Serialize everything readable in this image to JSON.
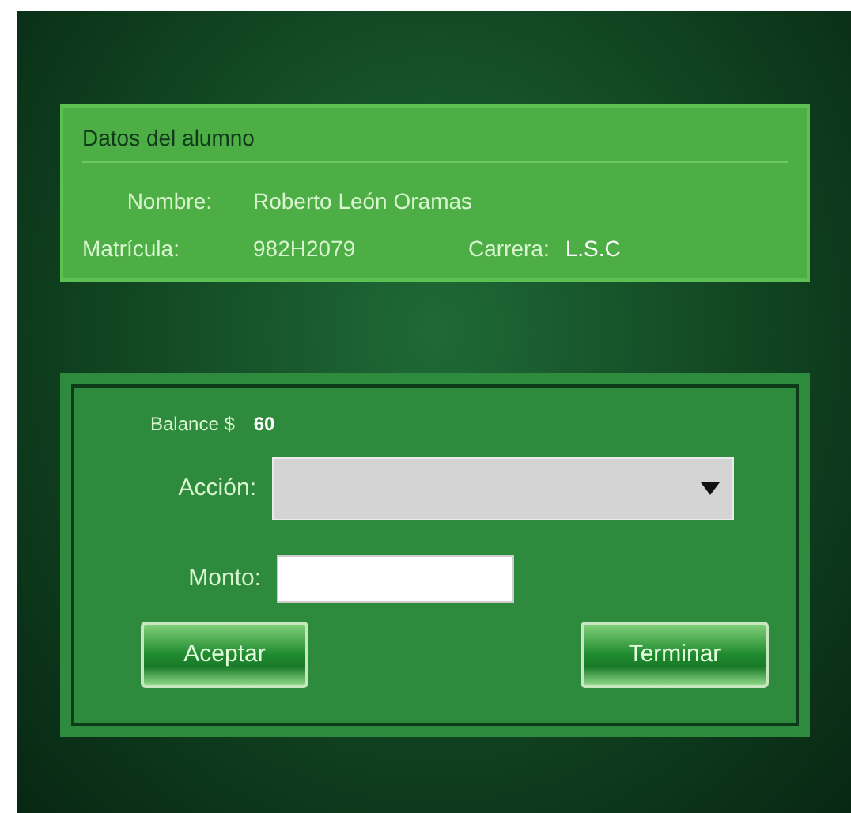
{
  "student_panel": {
    "title": "Datos del alumno",
    "name_label": "Nombre:",
    "name_value": "Roberto León Oramas",
    "id_label": "Matrícula:",
    "id_value": "982H2079",
    "career_label": "Carrera:",
    "career_value": "L.S.C"
  },
  "transaction_panel": {
    "balance_label": "Balance $",
    "balance_value": "60",
    "action_label": "Acción:",
    "amount_label": "Monto:",
    "buttons": [
      "Aceptar",
      "Terminar"
    ]
  }
}
